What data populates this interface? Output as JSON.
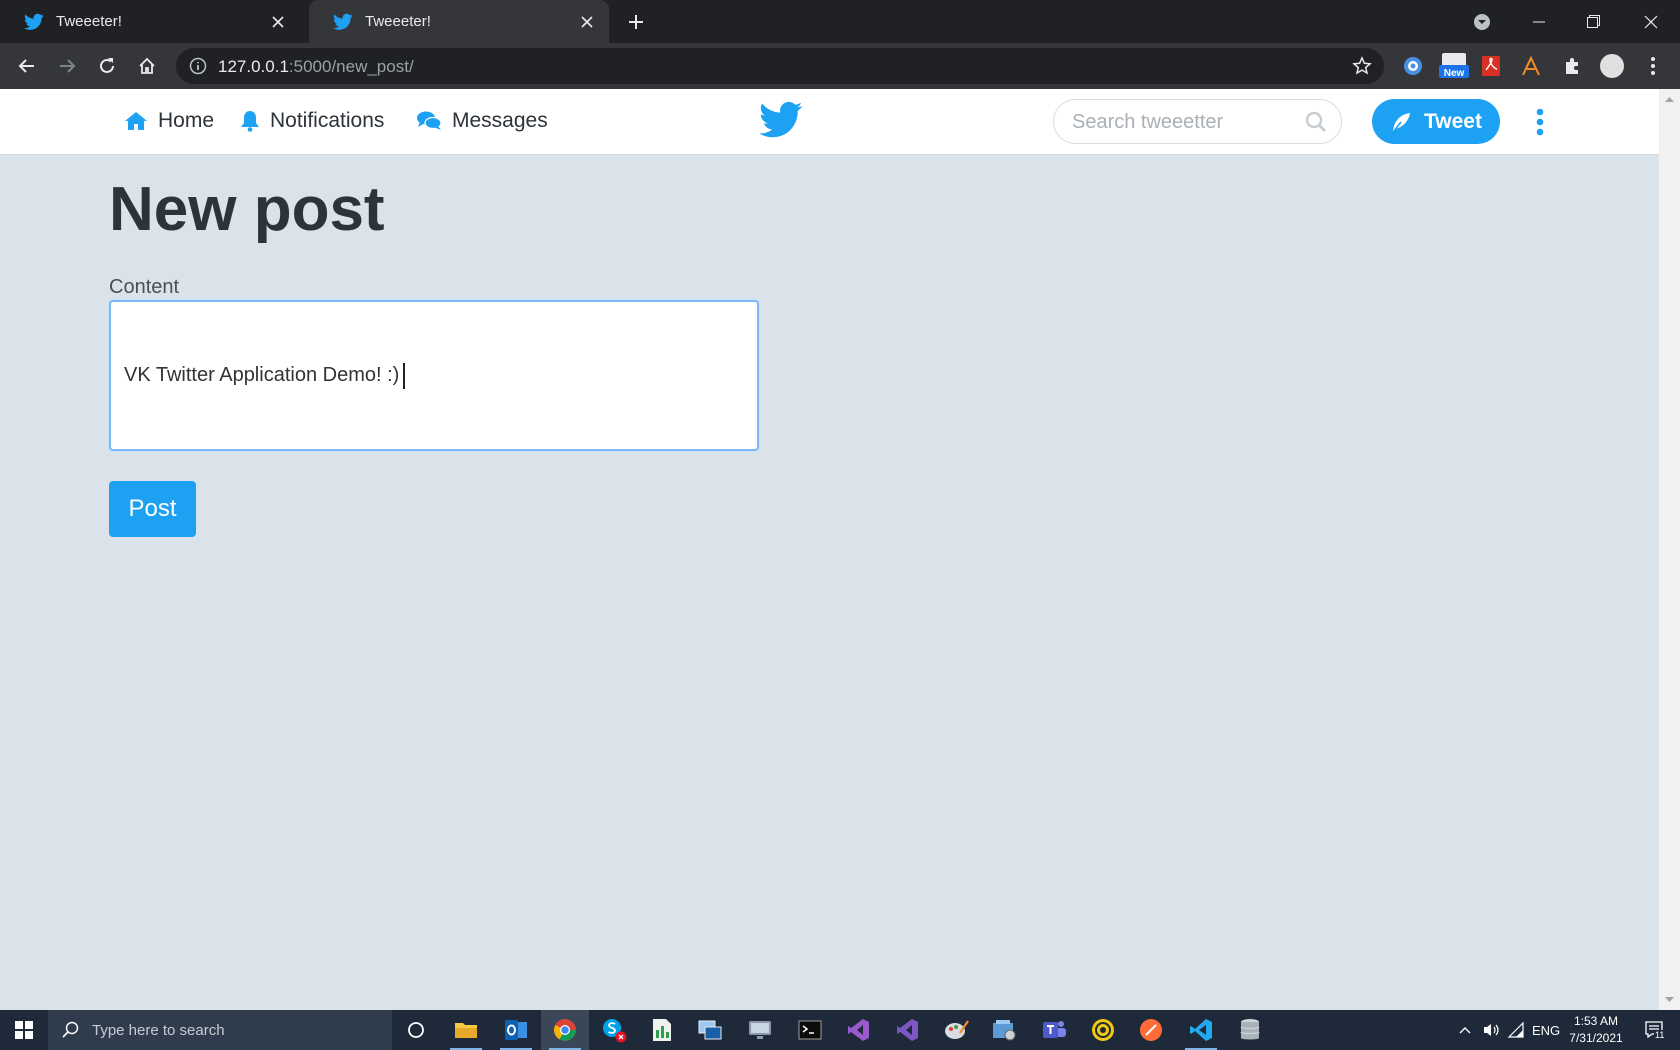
{
  "browser": {
    "tabs": [
      {
        "title": "Tweeeter!",
        "active": false
      },
      {
        "title": "Tweeeter!",
        "active": true
      }
    ],
    "url_host": "127.0.0.1",
    "url_path": ":5000/new_post/",
    "extension_new_badge": "New"
  },
  "site": {
    "nav": {
      "home_label": "Home",
      "notifications_label": "Notifications",
      "messages_label": "Messages"
    },
    "search_placeholder": "Search tweeetter",
    "tweet_button_label": "Tweet",
    "brand_color": "#1da1f2"
  },
  "form": {
    "title": "New post",
    "content_label": "Content",
    "content_value": "VK Twitter Application Demo! :)",
    "post_button_label": "Post"
  },
  "taskbar": {
    "search_placeholder": "Type here to search",
    "language": "ENG",
    "time": "1:53 AM",
    "date": "7/31/2021",
    "notification_count": "11"
  }
}
